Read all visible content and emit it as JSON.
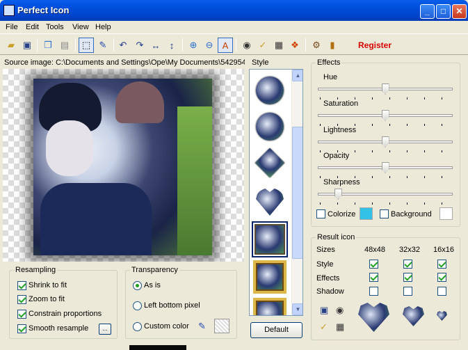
{
  "window": {
    "title": "Perfect Icon",
    "minimize": "_",
    "maximize": "□",
    "close": "✕"
  },
  "menu": [
    "File",
    "Edit",
    "Tools",
    "View",
    "Help"
  ],
  "toolbar": {
    "register": "Register",
    "icons": [
      "open-folder-icon",
      "save-icon",
      "copy-icon",
      "paste-icon",
      "select-rect-icon",
      "eyedropper-icon",
      "rotate-left-icon",
      "rotate-right-icon",
      "flip-horizontal-icon",
      "flip-vertical-icon",
      "zoom-in-icon",
      "zoom-out-icon",
      "auto-fit-icon",
      "preview-icon",
      "export-folder-icon",
      "extract-icon",
      "windows-icon",
      "settings-icon",
      "book-icon"
    ]
  },
  "source": {
    "label": "Source image: C:\\Documents and Settings\\Ope\\My Documents\\542954"
  },
  "style": {
    "label": "Style",
    "thumbs": [
      "circle",
      "circle",
      "diamond",
      "heart",
      "square",
      "framed-square",
      "framed-stamp"
    ],
    "selected_index": 4,
    "default_button": "Default"
  },
  "resampling": {
    "title": "Resampling",
    "options": [
      {
        "label": "Shrink to fit",
        "checked": true
      },
      {
        "label": "Zoom to fit",
        "checked": true
      },
      {
        "label": "Constrain proportions",
        "checked": true
      },
      {
        "label": "Smooth resample",
        "checked": true
      }
    ],
    "more_button": "..."
  },
  "transparency": {
    "title": "Transparency",
    "options": [
      {
        "label": "As is",
        "checked": true
      },
      {
        "label": "Left bottom pixel",
        "checked": false
      },
      {
        "label": "Custom color",
        "checked": false
      }
    ]
  },
  "effects": {
    "title": "Effects",
    "sliders": [
      {
        "label": "Hue",
        "value": 0.5
      },
      {
        "label": "Saturation",
        "value": 0.5
      },
      {
        "label": "Lightness",
        "value": 0.5
      },
      {
        "label": "Opacity",
        "value": 0.5
      },
      {
        "label": "Sharpness",
        "value": 0.13
      }
    ],
    "colorize": {
      "label": "Colorize",
      "checked": false,
      "color": "#33c2e6"
    },
    "background": {
      "label": "Background",
      "checked": false,
      "color": "#ffffff"
    }
  },
  "result": {
    "title": "Result icon",
    "sizes_label": "Sizes",
    "sizes": [
      "48x48",
      "32x32",
      "16x16"
    ],
    "rows": [
      {
        "label": "Style",
        "values": [
          true,
          true,
          true
        ]
      },
      {
        "label": "Effects",
        "values": [
          true,
          true,
          true
        ]
      },
      {
        "label": "Shadow",
        "values": [
          false,
          false,
          false
        ]
      }
    ],
    "action_icons": [
      "save-icon",
      "preview-icon",
      "export-folder-icon",
      "extract-icon"
    ]
  }
}
